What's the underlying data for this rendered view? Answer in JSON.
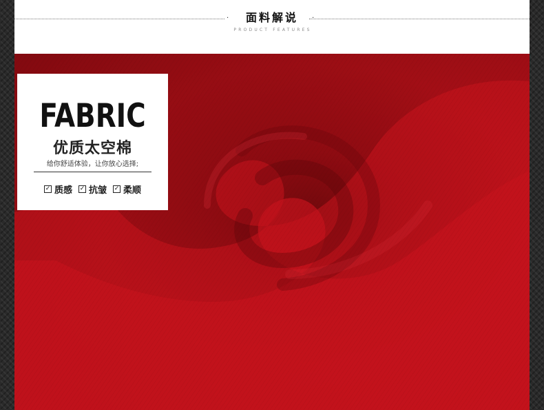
{
  "header": {
    "title": "面料解说",
    "subtitle": "PRODUCT FEATURES",
    "dot": "·"
  },
  "card": {
    "title": "FABRIC",
    "subtitle": "优质太空棉",
    "description": "给你舒适体验，让你放心选择;",
    "features": [
      {
        "label": "质感",
        "checked": true
      },
      {
        "label": "抗皱",
        "checked": true
      },
      {
        "label": "柔顺",
        "checked": true
      }
    ],
    "check_glyph": "✓"
  },
  "colors": {
    "fabric_red": "#b40f18",
    "card_bg": "#ffffff",
    "text_dark": "#111111"
  }
}
